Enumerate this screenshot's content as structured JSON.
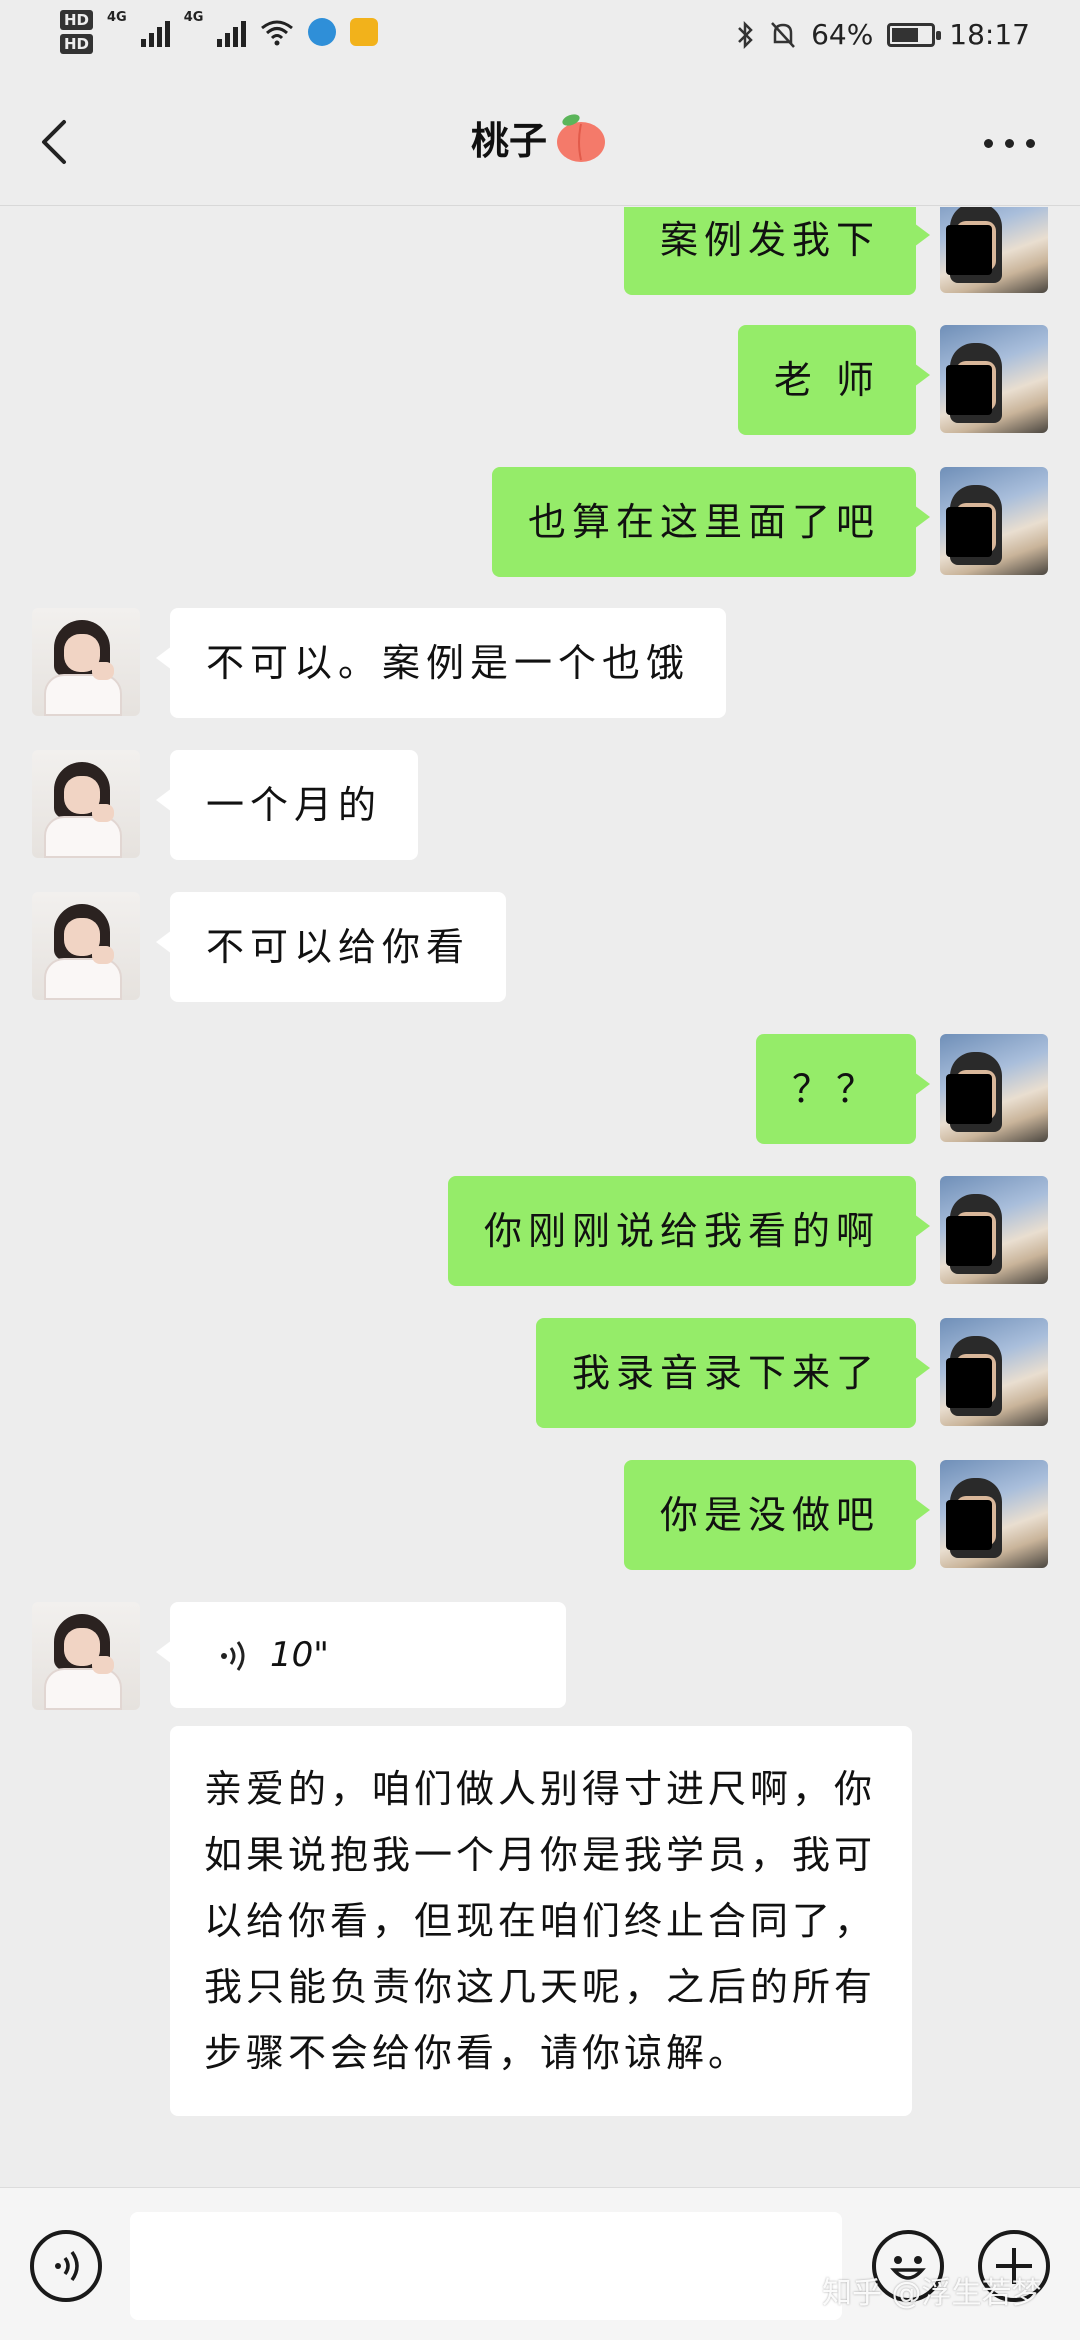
{
  "status_bar": {
    "hd1": "HD",
    "hd2": "HD",
    "net1": "4G",
    "net2": "4G",
    "battery_percent": "64%",
    "battery_level": 0.64,
    "time": "18:17"
  },
  "header": {
    "title": "桃子",
    "title_emoji_icon": "peach-icon"
  },
  "messages": [
    {
      "sender": "me",
      "text": "案例发我下"
    },
    {
      "sender": "me",
      "text": "老 师"
    },
    {
      "sender": "me",
      "text": "也算在这里面了吧"
    },
    {
      "sender": "her",
      "text": "不可以。案例是一个也饿"
    },
    {
      "sender": "her",
      "text": "一个月的"
    },
    {
      "sender": "her",
      "text": "不可以给你看"
    },
    {
      "sender": "me",
      "text": "？？"
    },
    {
      "sender": "me",
      "text": "你刚刚说给我看的啊"
    },
    {
      "sender": "me",
      "text": "我录音录下来了"
    },
    {
      "sender": "me",
      "text": "你是没做吧"
    },
    {
      "sender": "her",
      "type": "voice",
      "duration": "10\""
    },
    {
      "sender": "her",
      "text": "亲爱的，咱们做人别得寸进尺啊，你如果说抱我一个月你是我学员，我可以给你看，但现在咱们终止合同了，我只能负责你这几天呢，之后的所有步骤不会给你看，请你谅解。"
    }
  ],
  "input_bar": {
    "placeholder": "",
    "voice_icon": "voice-toggle-icon",
    "emoji_icon": "emoji-icon",
    "plus_icon": "plus-icon"
  },
  "watermark": "知乎 @浮生若梦"
}
